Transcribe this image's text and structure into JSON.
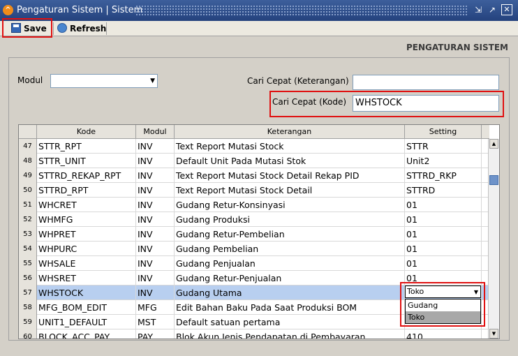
{
  "window": {
    "title": "Pengaturan Sistem | Sistem",
    "icon": "app-logo-icon"
  },
  "toolbar": {
    "save_label": "Save",
    "refresh_label": "Refresh"
  },
  "header": {
    "section_title": "PENGATURAN SISTEM"
  },
  "filters": {
    "modul_label": "Modul",
    "modul_value": "",
    "cari_keterangan_label": "Cari Cepat (Keterangan)",
    "cari_keterangan_value": "",
    "cari_kode_label": "Cari Cepat (Kode)",
    "cari_kode_value": "WHSTOCK"
  },
  "table": {
    "columns": [
      "Kode",
      "Modul",
      "Keterangan",
      "Setting"
    ],
    "rows": [
      {
        "no": "47",
        "kode": "STTR_RPT",
        "modul": "INV",
        "keterangan": "Text Report Mutasi Stock",
        "setting": "STTR"
      },
      {
        "no": "48",
        "kode": "STTR_UNIT",
        "modul": "INV",
        "keterangan": "Default Unit Pada Mutasi Stok",
        "setting": "Unit2"
      },
      {
        "no": "49",
        "kode": "STTRD_REKAP_RPT",
        "modul": "INV",
        "keterangan": "Text Report Mutasi Stock Detail Rekap PID",
        "setting": "STTRD_RKP"
      },
      {
        "no": "50",
        "kode": "STTRD_RPT",
        "modul": "INV",
        "keterangan": "Text Report Mutasi Stock Detail",
        "setting": "STTRD"
      },
      {
        "no": "51",
        "kode": "WHCRET",
        "modul": "INV",
        "keterangan": "Gudang Retur-Konsinyasi",
        "setting": "01"
      },
      {
        "no": "52",
        "kode": "WHMFG",
        "modul": "INV",
        "keterangan": "Gudang Produksi",
        "setting": "01"
      },
      {
        "no": "53",
        "kode": "WHPRET",
        "modul": "INV",
        "keterangan": "Gudang Retur-Pembelian",
        "setting": "01"
      },
      {
        "no": "54",
        "kode": "WHPURC",
        "modul": "INV",
        "keterangan": "Gudang Pembelian",
        "setting": "01"
      },
      {
        "no": "55",
        "kode": "WHSALE",
        "modul": "INV",
        "keterangan": "Gudang Penjualan",
        "setting": "01"
      },
      {
        "no": "56",
        "kode": "WHSRET",
        "modul": "INV",
        "keterangan": "Gudang Retur-Penjualan",
        "setting": "01"
      },
      {
        "no": "57",
        "kode": "WHSTOCK",
        "modul": "INV",
        "keterangan": "Gudang Utama",
        "setting": ""
      },
      {
        "no": "58",
        "kode": "MFG_BOM_EDIT",
        "modul": "MFG",
        "keterangan": "Edit Bahan Baku Pada Saat Produksi BOM",
        "setting": ""
      },
      {
        "no": "59",
        "kode": "UNIT1_DEFAULT",
        "modul": "MST",
        "keterangan": "Default satuan pertama",
        "setting": ""
      },
      {
        "no": "60",
        "kode": "BLOCK_ACC_PAY",
        "modul": "PAY",
        "keterangan": "Blok Akun Jenis Pendapatan di Pembayaran",
        "setting": "410"
      }
    ],
    "selected_row": "57"
  },
  "setting_dropdown": {
    "value": "Toko",
    "options": [
      "Gudang",
      "Toko"
    ],
    "highlighted": "Toko"
  },
  "colors": {
    "title_bar": "#24427d",
    "selected_row": "#b8cff0",
    "highlight_box": "#e01010"
  }
}
